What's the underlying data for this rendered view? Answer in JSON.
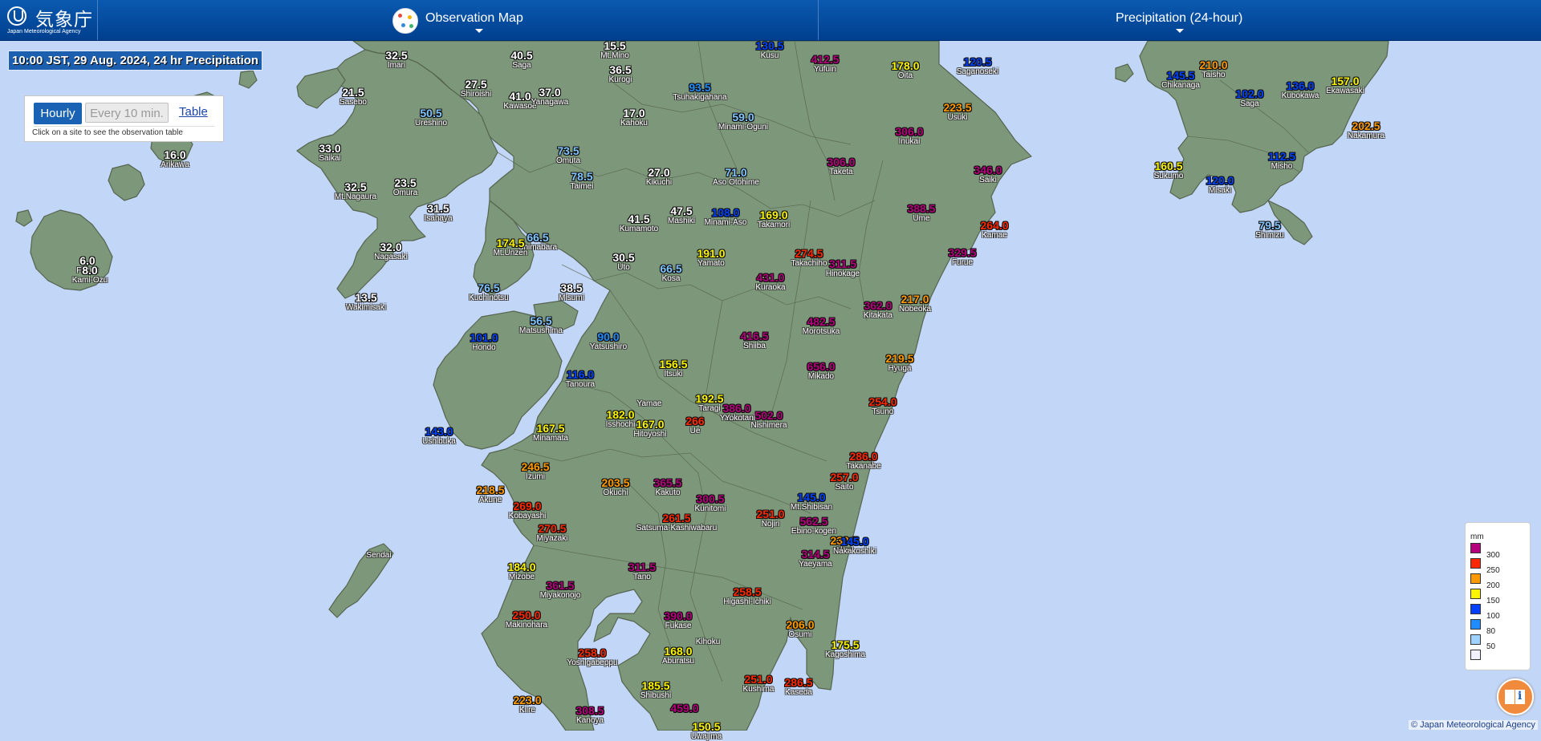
{
  "header": {
    "logo_jp": "気象庁",
    "logo_en": "Japan Meteorological Agency",
    "observation_menu": "Observation Map",
    "element_menu": "Precipitation (24-hour)"
  },
  "map_title": "10:00 JST, 29 Aug. 2024, 24 hr Precipitation",
  "panel": {
    "hourly_label": "Hourly",
    "ten_min_label": "Every 10 min.",
    "table_label": "Table",
    "hint": "Click on a site to see the observation table"
  },
  "legend": {
    "unit": "mm",
    "items": [
      {
        "label": "300",
        "color": "#b4007a"
      },
      {
        "label": "250",
        "color": "#ff2800"
      },
      {
        "label": "200",
        "color": "#ff9900"
      },
      {
        "label": "150",
        "color": "#faf500"
      },
      {
        "label": "100",
        "color": "#0041ff"
      },
      {
        "label": "80",
        "color": "#218cff"
      },
      {
        "label": "50",
        "color": "#a0d2ff"
      },
      {
        "label": "",
        "color": "#f2f2ff"
      }
    ]
  },
  "colors": {
    "sea": "#c2d6f7",
    "land": "#7d977a",
    "border": "#55654f",
    "header": "#0a5ab0"
  },
  "copyright": "© Japan Meteorological Agency",
  "stations": [
    {
      "value": "32.5",
      "name": "Imari"
    },
    {
      "value": "40.5",
      "name": "Saga"
    },
    {
      "value": "15.5",
      "name": "Mt.Mino"
    },
    {
      "value": "36.5",
      "name": "Kurogi"
    },
    {
      "value": "130.5",
      "name": "Kusu"
    },
    {
      "value": "412.5",
      "name": "Yufuin"
    },
    {
      "value": "178.0",
      "name": "Oita"
    },
    {
      "value": "120.5",
      "name": "Saganoseki"
    },
    {
      "value": "21.5",
      "name": "Sasebo"
    },
    {
      "value": "27.5",
      "name": "Shiroishi"
    },
    {
      "value": "41.0",
      "name": "Kawasoe"
    },
    {
      "value": "37.0",
      "name": "Yanagawa"
    },
    {
      "value": "93.5",
      "name": "Tsuhakigahana"
    },
    {
      "value": "223.5",
      "name": "Usuki"
    },
    {
      "value": "50.5",
      "name": "Ureshino"
    },
    {
      "value": "17.0",
      "name": "Kahoku"
    },
    {
      "value": "59.0",
      "name": "Minami-Oguni"
    },
    {
      "value": "306.0",
      "name": "Inukai"
    },
    {
      "value": "33.0",
      "name": "Saikai"
    },
    {
      "value": "16.0",
      "name": "Arikawa"
    },
    {
      "value": "73.5",
      "name": "Omuta"
    },
    {
      "value": "306.0",
      "name": "Taketa"
    },
    {
      "value": "346.0",
      "name": "Saiki"
    },
    {
      "value": "32.5",
      "name": "Mt.Nagaura"
    },
    {
      "value": "23.5",
      "name": "Omura"
    },
    {
      "value": "27.0",
      "name": "Kikuchi"
    },
    {
      "value": "71.0",
      "name": "Aso Otohime"
    },
    {
      "value": "78.5",
      "name": "Taimei"
    },
    {
      "value": "31.5",
      "name": "Isahaya"
    },
    {
      "value": "41.5",
      "name": "Kumamoto"
    },
    {
      "value": "47.5",
      "name": "Mashiki"
    },
    {
      "value": "108.0",
      "name": "Minami-Aso"
    },
    {
      "value": "169.0",
      "name": "Takamori"
    },
    {
      "value": "388.5",
      "name": "Ume"
    },
    {
      "value": "264.0",
      "name": "Kamae"
    },
    {
      "value": "66.5",
      "name": "Shimabara"
    },
    {
      "value": "174.5",
      "name": "Mt.Unzen"
    },
    {
      "value": "32.0",
      "name": "Nagasaki"
    },
    {
      "value": "191.0",
      "name": "Yamato"
    },
    {
      "value": "274.5",
      "name": "Takachiho"
    },
    {
      "value": "311.5",
      "name": "Hinokage"
    },
    {
      "value": "329.5",
      "name": "Furue"
    },
    {
      "value": "6.0",
      "name": "Fukue"
    },
    {
      "value": "8.0",
      "name": "Kami-Ozu"
    },
    {
      "value": "30.5",
      "name": "Uto"
    },
    {
      "value": "66.5",
      "name": "Kosa"
    },
    {
      "value": "431.0",
      "name": "Kuraoka"
    },
    {
      "value": "76.5",
      "name": "Kuchinotsu"
    },
    {
      "value": "38.5",
      "name": "Misumi"
    },
    {
      "value": "362.0",
      "name": "Kitakata"
    },
    {
      "value": "217.0",
      "name": "Nobeoka"
    },
    {
      "value": "13.5",
      "name": "Wakimisaki"
    },
    {
      "value": "56.5",
      "name": "Matsushima"
    },
    {
      "value": "482.5",
      "name": "Morotsuka"
    },
    {
      "value": "101.0",
      "name": "Hondo"
    },
    {
      "value": "90.0",
      "name": "Yatsushiro"
    },
    {
      "value": "416.5",
      "name": "Shiiba"
    },
    {
      "value": "156.5",
      "name": "Itsuki"
    },
    {
      "value": "219.5",
      "name": "Hyuga"
    },
    {
      "value": "656.0",
      "name": "Mikado"
    },
    {
      "value": "116.0",
      "name": "Tanoura"
    },
    {
      "value": "192.5",
      "name": "Taragi"
    },
    {
      "value": "386.0",
      "name": "Yunomae"
    },
    {
      "value": "502.0",
      "name": "Nishimera"
    },
    {
      "value": "254.0",
      "name": "Tsuno"
    },
    {
      "value": "",
      "name": "Yamae"
    },
    {
      "value": "182.0",
      "name": "Isshochi"
    },
    {
      "value": "167.0",
      "name": "Hitoyoshi"
    },
    {
      "value": "266",
      "name": "Ue"
    },
    {
      "value": "",
      "name": "Yokotani"
    },
    {
      "value": "167.5",
      "name": "Minamata"
    },
    {
      "value": "143.0",
      "name": "Ushibuka"
    },
    {
      "value": "286.0",
      "name": "Takanabe"
    },
    {
      "value": "246.5",
      "name": "Izumi"
    },
    {
      "value": "257.0",
      "name": "Saito"
    },
    {
      "value": "218.5",
      "name": "Akune"
    },
    {
      "value": "203.5",
      "name": "Okuchi"
    },
    {
      "value": "365.5",
      "name": "Kakuto"
    },
    {
      "value": "145.0",
      "name": "Mt.Shibisan"
    },
    {
      "value": "269.0",
      "name": "Kobayashi"
    },
    {
      "value": "300.5",
      "name": "Kunitomi"
    },
    {
      "value": "562.5",
      "name": "Ebino-kogen"
    },
    {
      "value": "261.5",
      "name": "Satsuma-Kashiwabaru"
    },
    {
      "value": "251.0",
      "name": "Nojiri"
    },
    {
      "value": "270.5",
      "name": "Miyazaki"
    },
    {
      "value": "230.5",
      "name": "Akae"
    },
    {
      "value": "145.0",
      "name": "Nakakoshiki"
    },
    {
      "value": "",
      "name": "Sendai"
    },
    {
      "value": "184.0",
      "name": "Mizobe"
    },
    {
      "value": "311.5",
      "name": "Tano"
    },
    {
      "value": "314.5",
      "name": "Yaeyama"
    },
    {
      "value": "361.5",
      "name": "Miyakonojo"
    },
    {
      "value": "258.5",
      "name": "Higashi-Ichiki"
    },
    {
      "value": "250.0",
      "name": "Makinohara"
    },
    {
      "value": "390.0",
      "name": "Fukase"
    },
    {
      "value": "206.0",
      "name": "Osumi"
    },
    {
      "value": "",
      "name": "Kihoku"
    },
    {
      "value": "168.0",
      "name": "Aburatsu"
    },
    {
      "value": "175.5",
      "name": "Kagoshima"
    },
    {
      "value": "258.0",
      "name": "Yoshigabeppu"
    },
    {
      "value": "185.5",
      "name": "Shibushi"
    },
    {
      "value": "251.0",
      "name": "Kushima"
    },
    {
      "value": "286.5",
      "name": "Kaseda"
    },
    {
      "value": "223.0",
      "name": "Kiire"
    },
    {
      "value": "308.5",
      "name": "Kanoya"
    },
    {
      "value": "459.0",
      "name": ""
    },
    {
      "value": "150.5",
      "name": "Uwajima"
    },
    {
      "value": "145.5",
      "name": "Chikanaga"
    },
    {
      "value": "210.0",
      "name": "Taisho"
    },
    {
      "value": "136.0",
      "name": "Kubokawa"
    },
    {
      "value": "157.0",
      "name": "Ekawasaki"
    },
    {
      "value": "102.0",
      "name": "Saga"
    },
    {
      "value": "202.5",
      "name": "Nakamura"
    },
    {
      "value": "112.5",
      "name": "Misho"
    },
    {
      "value": "160.5",
      "name": "Sukumo"
    },
    {
      "value": "120.0",
      "name": "Misaki"
    },
    {
      "value": "79.5",
      "name": "Shimizu"
    }
  ]
}
